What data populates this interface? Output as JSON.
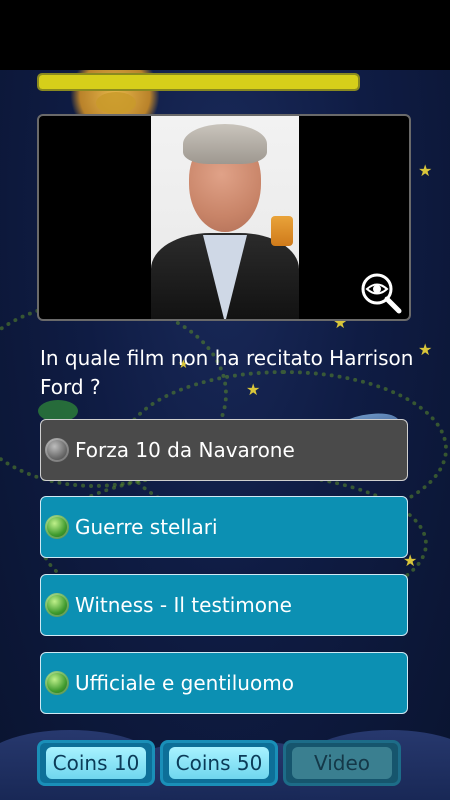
{
  "progress": {
    "fraction": 1.0,
    "color": "#d6cf1a"
  },
  "photo": {
    "subject_alt": "portrait photo",
    "zoom_icon": "magnify-eye-icon"
  },
  "question": {
    "text": "In quale film non ha recitato Harrison Ford ?"
  },
  "answers": [
    {
      "label": "Forza 10 da Navarone",
      "state": "selected"
    },
    {
      "label": "Guerre stellari",
      "state": "normal"
    },
    {
      "label": "Witness - Il testimone",
      "state": "normal"
    },
    {
      "label": "Ufficiale e gentiluomo",
      "state": "normal"
    }
  ],
  "bottom_buttons": [
    {
      "label": "Coins 10",
      "enabled": true
    },
    {
      "label": "Coins 50",
      "enabled": true
    },
    {
      "label": "Video",
      "enabled": false
    }
  ],
  "colors": {
    "answer_bg": "#0c90b3",
    "answer_selected_bg": "#4a4a4a",
    "background": "#0f1c44"
  }
}
